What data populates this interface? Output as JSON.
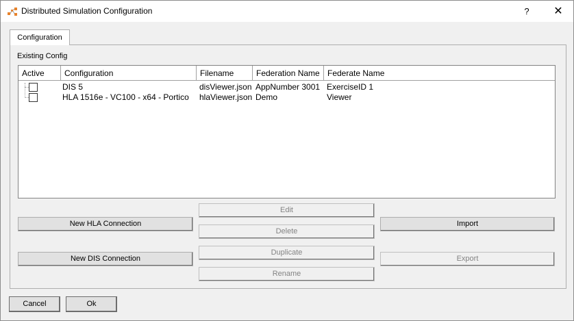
{
  "window": {
    "title": "Distributed Simulation Configuration",
    "help_label": "?",
    "close_label": "✕"
  },
  "tabs": [
    {
      "label": "Configuration"
    }
  ],
  "group": {
    "label": "Existing Config"
  },
  "table": {
    "columns": [
      "Active",
      "Configuration",
      "Filename",
      "Federation Name",
      "Federate Name"
    ],
    "rows": [
      {
        "active": false,
        "configuration": "DIS 5",
        "filename": "disViewer.json",
        "federation_name": "AppNumber 3001",
        "federate_name": "ExerciseID 1"
      },
      {
        "active": false,
        "configuration": "HLA 1516e - VC100 - x64 - Portico",
        "filename": "hlaViewer.json",
        "federation_name": "Demo",
        "federate_name": "Viewer"
      }
    ]
  },
  "buttons": {
    "new_hla": "New HLA Connection",
    "new_dis": "New DIS Connection",
    "edit": "Edit",
    "delete": "Delete",
    "duplicate": "Duplicate",
    "rename": "Rename",
    "import": "Import",
    "export": "Export",
    "cancel": "Cancel",
    "ok": "Ok"
  },
  "colors": {
    "icon_orange": "#e8822a",
    "disabled_text": "#838383"
  }
}
